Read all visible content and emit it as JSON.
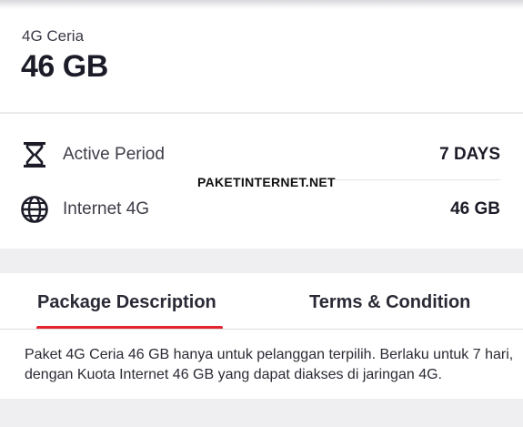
{
  "package": {
    "name": "4G Ceria",
    "size": "46 GB"
  },
  "details": {
    "active_period": {
      "label": "Active Period",
      "value": "7 DAYS",
      "icon": "hourglass-icon"
    },
    "internet": {
      "label": "Internet 4G",
      "value": "46 GB",
      "icon": "globe-icon"
    }
  },
  "watermark": "PAKETINTERNET.NET",
  "tabs": [
    {
      "label": "Package Description",
      "active": true
    },
    {
      "label": "Terms & Condition",
      "active": false
    }
  ],
  "description": "Paket 4G Ceria 46 GB hanya untuk pelanggan terpilih. Berlaku untuk 7 hari, dengan Kuota Internet 46 GB yang dapat diakses di jaringan 4G.",
  "colors": {
    "accent": "#e3232d",
    "text": "#1c1c28",
    "background": "#efeff1"
  }
}
